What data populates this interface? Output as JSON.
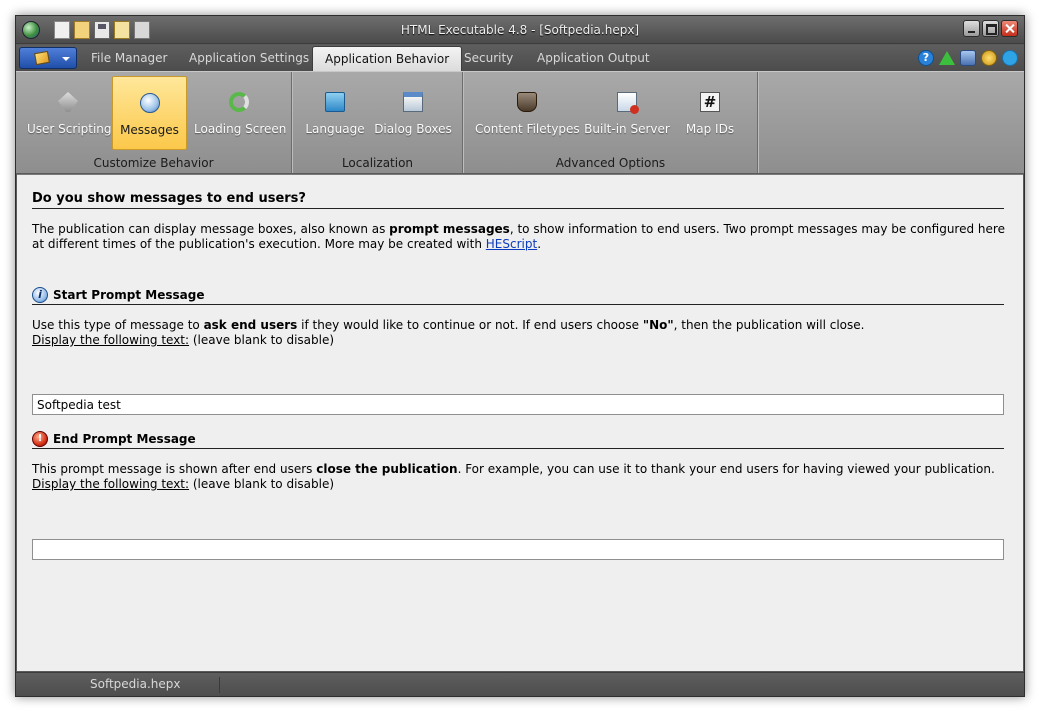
{
  "window": {
    "title": "HTML Executable 4.8 - [Softpedia.hepx]"
  },
  "quick_access": [
    "new-icon",
    "open-folder-icon",
    "save-icon",
    "edit-icon",
    "properties-icon"
  ],
  "tabs": [
    {
      "label": "File Manager",
      "active": false
    },
    {
      "label": "Application Settings",
      "active": false
    },
    {
      "label": "Application Behavior",
      "active": true
    },
    {
      "label": "Security",
      "active": false
    },
    {
      "label": "Application Output",
      "active": false
    }
  ],
  "help_icons": [
    "help-icon",
    "update-icon",
    "users-icon",
    "award-icon",
    "twitter-icon"
  ],
  "ribbon": {
    "groups": [
      {
        "label": "Customize Behavior",
        "buttons": [
          {
            "label": "User Scripting",
            "icon": "user-scripting-icon"
          },
          {
            "label": "Messages",
            "icon": "messages-icon",
            "selected": true
          },
          {
            "label": "Loading Screen",
            "icon": "loading-screen-icon"
          }
        ]
      },
      {
        "label": "Localization",
        "buttons": [
          {
            "label": "Language",
            "icon": "language-icon"
          },
          {
            "label": "Dialog Boxes",
            "icon": "dialog-boxes-icon"
          }
        ]
      },
      {
        "label": "Advanced Options",
        "buttons": [
          {
            "label": "Content Filetypes",
            "icon": "content-filetypes-icon"
          },
          {
            "label": "Built-in Server",
            "icon": "built-in-server-icon"
          },
          {
            "label": "Map IDs",
            "icon": "map-ids-icon"
          }
        ]
      }
    ],
    "map_ids_glyph": "#"
  },
  "content": {
    "heading": "Do you show messages to end users?",
    "intro_part1": "The publication can display message boxes, also known as ",
    "intro_bold": "prompt messages",
    "intro_part2": ", to show information to end users. Two prompt messages may be configured here at different times of the publication's execution. More may be created with ",
    "intro_link": "HEScript",
    "intro_end": ".",
    "start": {
      "title": "Start Prompt Message",
      "desc_part1": "Use this type of message to ",
      "desc_bold": "ask end users",
      "desc_part2": " if they would like to continue or not. If end users choose ",
      "desc_bold2": "\"No\"",
      "desc_part3": ", then the publication will close.",
      "display_label": "Display the following text:",
      "display_hint": " (leave blank to disable)",
      "value": "Softpedia test"
    },
    "end": {
      "title": "End Prompt Message",
      "desc_part1": "This prompt message is shown after end users ",
      "desc_bold": "close the publication",
      "desc_part2": ". For example, you can use it to thank your end users for having viewed your publication.",
      "display_label": "Display the following text:",
      "display_hint": " (leave blank to disable)",
      "value": ""
    }
  },
  "status": {
    "document": "Softpedia.hepx"
  },
  "colors": {
    "selected_button": "#fbc84a",
    "link": "#0a3bbd",
    "content_bg": "#efefef"
  }
}
